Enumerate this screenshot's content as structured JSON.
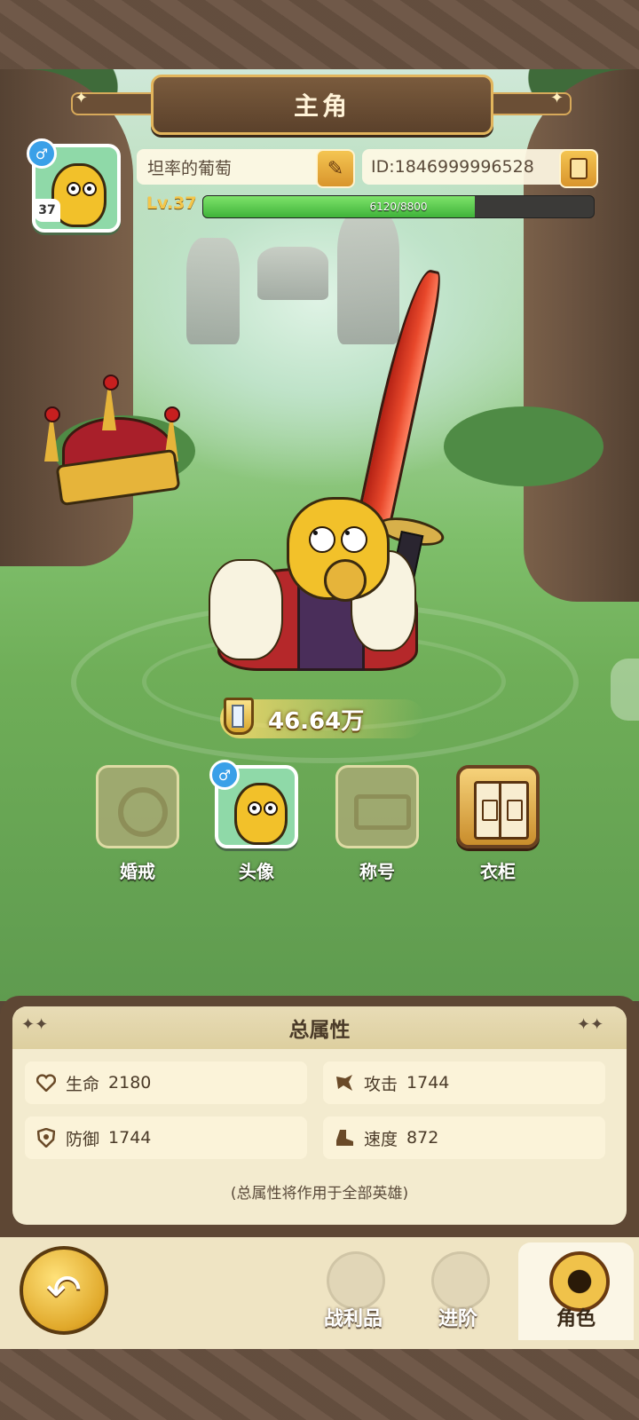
{
  "header": {
    "title": "主角"
  },
  "profile": {
    "level_badge": "37",
    "gender_symbol": "♂",
    "name": "坦率的葡萄",
    "id_text": "ID:1846999996528",
    "level_label": "Lv.37",
    "xp_text": "6120/8800",
    "xp_current": 6120,
    "xp_max": 8800
  },
  "power": {
    "value": "46.64万"
  },
  "features": [
    {
      "label": "婚戒",
      "icon": "ring-icon",
      "state": "locked"
    },
    {
      "label": "头像",
      "icon": "avatar-icon",
      "state": "active"
    },
    {
      "label": "称号",
      "icon": "title-icon",
      "state": "locked"
    },
    {
      "label": "衣柜",
      "icon": "wardrobe-book-icon",
      "state": "available"
    }
  ],
  "attributes": {
    "title": "总属性",
    "stats": [
      {
        "name": "生命",
        "value": "2180",
        "icon": "heart-icon"
      },
      {
        "name": "攻击",
        "value": "1744",
        "icon": "attack-icon"
      },
      {
        "name": "防御",
        "value": "1744",
        "icon": "shield-icon"
      },
      {
        "name": "速度",
        "value": "872",
        "icon": "boot-icon"
      }
    ],
    "note": "(总属性将作用于全部英雄)"
  },
  "nav": {
    "tabs": [
      {
        "label": "战利品",
        "icon": "loot-icon"
      },
      {
        "label": "进阶",
        "icon": "advance-icon"
      },
      {
        "label": "角色",
        "icon": "character-icon"
      }
    ],
    "active": "角色"
  },
  "colors": {
    "accent": "#f4c64a",
    "xp_green": "#3fb33a",
    "panel_bg": "#f3ebcf",
    "wood": "#6b5443"
  }
}
